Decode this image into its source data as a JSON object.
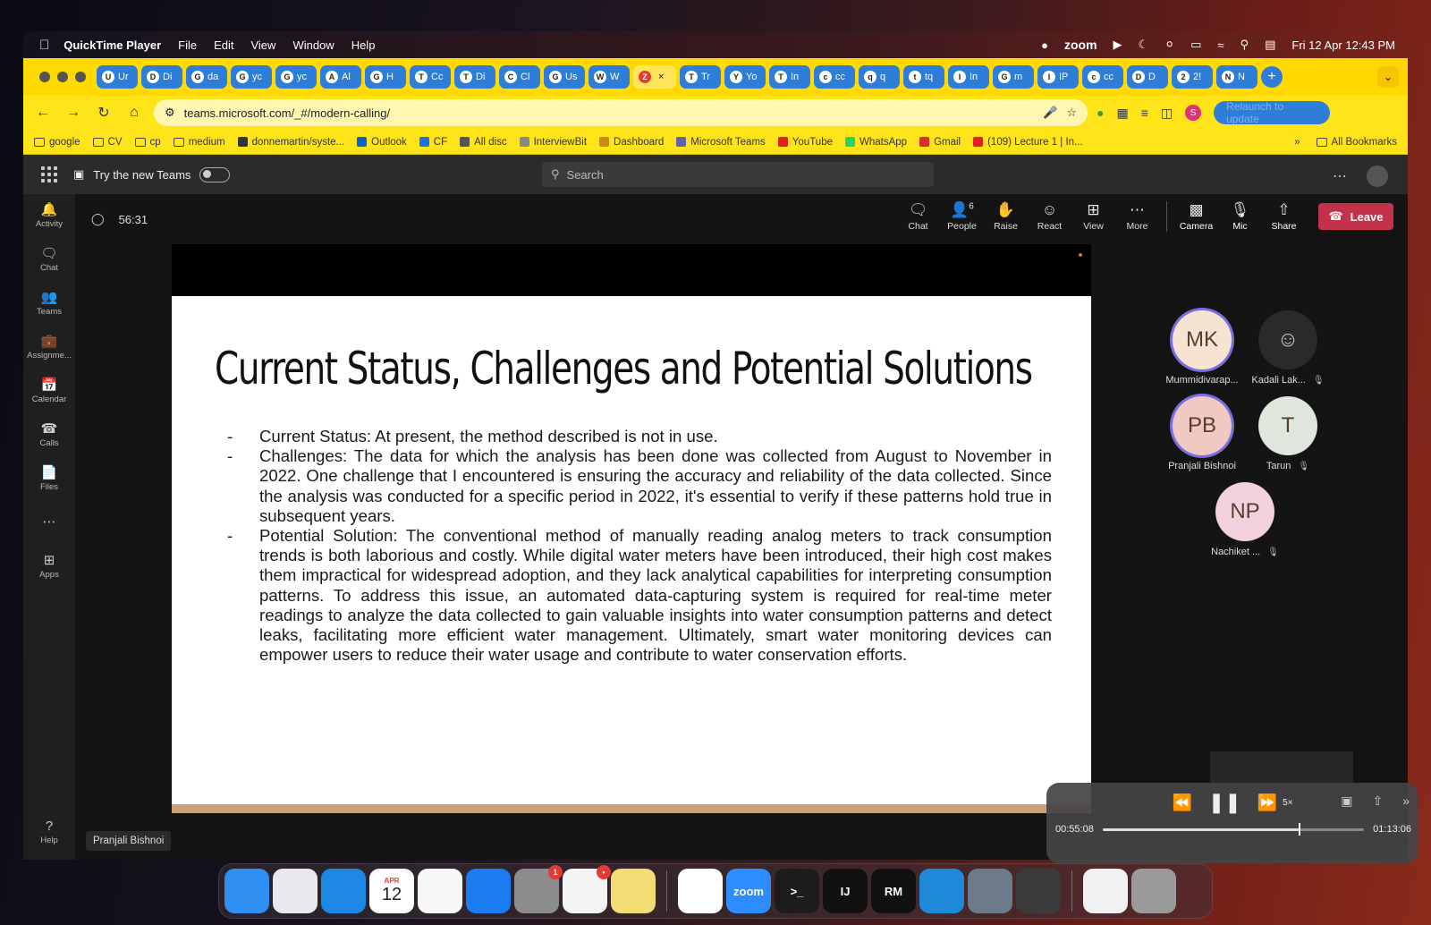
{
  "menubar": {
    "app": "QuickTime Player",
    "items": [
      "File",
      "Edit",
      "View",
      "Window",
      "Help"
    ],
    "status_app": "zoom",
    "datetime": "Fri 12 Apr  12:43 PM"
  },
  "browser": {
    "tabs": [
      {
        "label": "Ur",
        "icon": "U"
      },
      {
        "label": "Di",
        "icon": "D"
      },
      {
        "label": "da",
        "icon": "G"
      },
      {
        "label": "yc",
        "icon": "G"
      },
      {
        "label": "yc",
        "icon": "G"
      },
      {
        "label": "Al",
        "icon": "A"
      },
      {
        "label": "H",
        "icon": "G"
      },
      {
        "label": "Cc",
        "icon": "T"
      },
      {
        "label": "Di",
        "icon": "T"
      },
      {
        "label": "Cl",
        "icon": "C"
      },
      {
        "label": "Us",
        "icon": "G"
      },
      {
        "label": "W",
        "icon": "W"
      },
      {
        "label": "",
        "icon": "Z"
      },
      {
        "label": "Tr",
        "icon": "T"
      },
      {
        "label": "Yo",
        "icon": "Y"
      },
      {
        "label": "In",
        "icon": "T"
      },
      {
        "label": "cc",
        "icon": "c"
      },
      {
        "label": "q",
        "icon": "q"
      },
      {
        "label": "tq",
        "icon": "t"
      },
      {
        "label": "In",
        "icon": "I"
      },
      {
        "label": "m",
        "icon": "G"
      },
      {
        "label": "IP",
        "icon": "I"
      },
      {
        "label": "cc",
        "icon": "c"
      },
      {
        "label": "D",
        "icon": "D"
      },
      {
        "label": "2!",
        "icon": "2"
      },
      {
        "label": "N",
        "icon": "N"
      }
    ],
    "active_tab_index": 12,
    "url": "teams.microsoft.com/_#/modern-calling/",
    "profile_initial": "S",
    "relaunch_label": "Relaunch to update",
    "bookmarks": [
      "google",
      "CV",
      "cp",
      "medium",
      "donnemartin/syste...",
      "Outlook",
      "CF",
      "All disc",
      "InterviewBit",
      "Dashboard",
      "Microsoft Teams",
      "YouTube",
      "WhatsApp",
      "Gmail",
      "(109) Lecture 1 | In..."
    ],
    "all_bookmarks": "All Bookmarks"
  },
  "teams": {
    "try_new": "Try the new Teams",
    "search_placeholder": "Search",
    "rail": [
      {
        "label": "Activity",
        "icon": "bell-icon"
      },
      {
        "label": "Chat",
        "icon": "chat-icon"
      },
      {
        "label": "Teams",
        "icon": "teams-icon"
      },
      {
        "label": "Assignme...",
        "icon": "assignments-icon"
      },
      {
        "label": "Calendar",
        "icon": "calendar-icon"
      },
      {
        "label": "Calls",
        "icon": "phone-icon"
      },
      {
        "label": "Files",
        "icon": "file-icon"
      },
      {
        "label": "",
        "icon": "ellipsis-icon"
      },
      {
        "label": "Apps",
        "icon": "apps-icon"
      }
    ],
    "help_label": "Help",
    "meeting": {
      "timer": "56:31",
      "controls": {
        "chat": "Chat",
        "people": "People",
        "people_count": "6",
        "raise": "Raise",
        "react": "React",
        "view": "View",
        "more": "More",
        "camera": "Camera",
        "mic": "Mic",
        "share": "Share",
        "leave": "Leave"
      },
      "presenter_tag": "Pranjali Bishnoi",
      "participants": [
        {
          "initials": "MK",
          "name": "Mummidivarap...",
          "bg": "#f6e3d2",
          "ring": "#7b6fe0",
          "muted": false
        },
        {
          "initials": "",
          "name": "Kadali Lak...",
          "bg": "#2a2a2a",
          "ring": "",
          "muted": true
        },
        {
          "initials": "PB",
          "name": "Pranjali Bishnoi",
          "bg": "#f0c9c2",
          "ring": "#7b6fe0",
          "muted": false
        },
        {
          "initials": "T",
          "name": "Tarun",
          "bg": "#dfe6dc",
          "ring": "",
          "muted": true
        },
        {
          "initials": "NP",
          "name": "Nachiket ...",
          "bg": "#f3d1de",
          "ring": "",
          "muted": true
        }
      ]
    }
  },
  "slide": {
    "title": "Current Status, Challenges and Potential Solutions",
    "bullets": [
      "Current Status: At present, the method described is not in use.",
      "Challenges: The data for which the analysis has been done was collected from August to November in 2022. One challenge that I encountered is ensuring the accuracy and reliability of the data collected. Since the analysis was conducted for a specific period in 2022, it's essential to verify if these patterns hold true in subsequent years.",
      "Potential Solution: The conventional method of manually reading analog meters to track consumption trends is both laborious and costly. While digital water meters have been introduced, their high cost makes them impractical for widespread adoption, and they lack analytical capabilities for interpreting consumption patterns. To address this issue, an automated data-capturing system is required for real-time meter readings to analyze the data collected to gain valuable insights into water consumption patterns and detect leaks, facilitating more efficient water management. Ultimately, smart water monitoring devices can empower users to reduce their water usage and contribute to water conservation efforts."
    ]
  },
  "quicktime": {
    "elapsed": "00:55:08",
    "remaining": "01:13:06",
    "speed": "5×",
    "progress_fraction": 0.75
  },
  "dock": {
    "apps": [
      {
        "name": "Finder",
        "label": "",
        "bg": "#2f8ff3",
        "badge": ""
      },
      {
        "name": "Launchpad",
        "label": "",
        "bg": "#e8e8ee",
        "badge": ""
      },
      {
        "name": "Safari",
        "label": "",
        "bg": "#1e88e5",
        "badge": ""
      },
      {
        "name": "Calendar",
        "label": "12",
        "bg": "#ffffff",
        "badge": ""
      },
      {
        "name": "Notes",
        "label": "",
        "bg": "#f7f7f7",
        "badge": ""
      },
      {
        "name": "App Store",
        "label": "",
        "bg": "#1c7cf4",
        "badge": ""
      },
      {
        "name": "System Settings",
        "label": "",
        "bg": "#8c8c8c",
        "badge": "1"
      },
      {
        "name": "Slack",
        "label": "",
        "bg": "#f4f4f4",
        "badge": "•"
      },
      {
        "name": "Stickies",
        "label": "",
        "bg": "#f2dc73",
        "badge": ""
      },
      {
        "name": "Chrome",
        "label": "",
        "bg": "#ffffff",
        "badge": ""
      },
      {
        "name": "Zoom",
        "label": "zoom",
        "bg": "#2d8cff",
        "badge": ""
      },
      {
        "name": "Terminal",
        "label": ">_",
        "bg": "#1c1c1c",
        "badge": ""
      },
      {
        "name": "IntelliJ IDEA",
        "label": "IJ",
        "bg": "#111111",
        "badge": ""
      },
      {
        "name": "RubyMine",
        "label": "RM",
        "bg": "#111111",
        "badge": ""
      },
      {
        "name": "VS Code",
        "label": "",
        "bg": "#1f88d8",
        "badge": ""
      },
      {
        "name": "Preview",
        "label": "",
        "bg": "#6c7a8a",
        "badge": ""
      },
      {
        "name": "QuickTime",
        "label": "",
        "bg": "#3b3b3b",
        "badge": ""
      },
      {
        "name": "Document",
        "label": "",
        "bg": "#f1f1f1",
        "badge": ""
      },
      {
        "name": "Trash",
        "label": "",
        "bg": "#9a9a9a",
        "badge": ""
      }
    ],
    "calendar_month": "APR"
  }
}
